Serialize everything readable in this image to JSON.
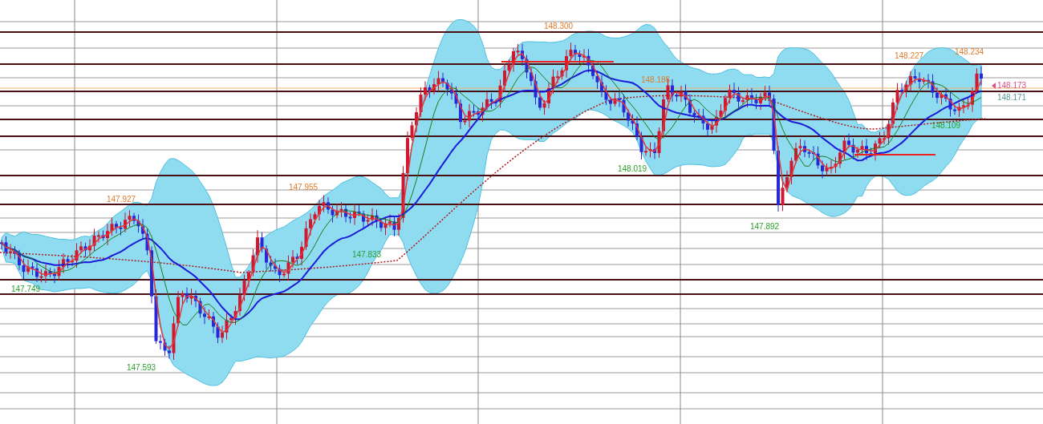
{
  "chart": {
    "price_labels": [
      {
        "text": "147.927",
        "kind": "high"
      },
      {
        "text": "147.749",
        "kind": "low"
      },
      {
        "text": "147.593",
        "kind": "low"
      },
      {
        "text": "147.955",
        "kind": "high"
      },
      {
        "text": "147.833",
        "kind": "low"
      },
      {
        "text": "148.300",
        "kind": "high"
      },
      {
        "text": "148.186",
        "kind": "high"
      },
      {
        "text": "148.019",
        "kind": "low"
      },
      {
        "text": "147.892",
        "kind": "low"
      },
      {
        "text": "148.227",
        "kind": "high"
      },
      {
        "text": "148.109",
        "kind": "low"
      },
      {
        "text": "148.234",
        "kind": "high"
      },
      {
        "text": "148.173",
        "kind": "current"
      },
      {
        "text": "148.171",
        "kind": "bid"
      }
    ]
  }
}
